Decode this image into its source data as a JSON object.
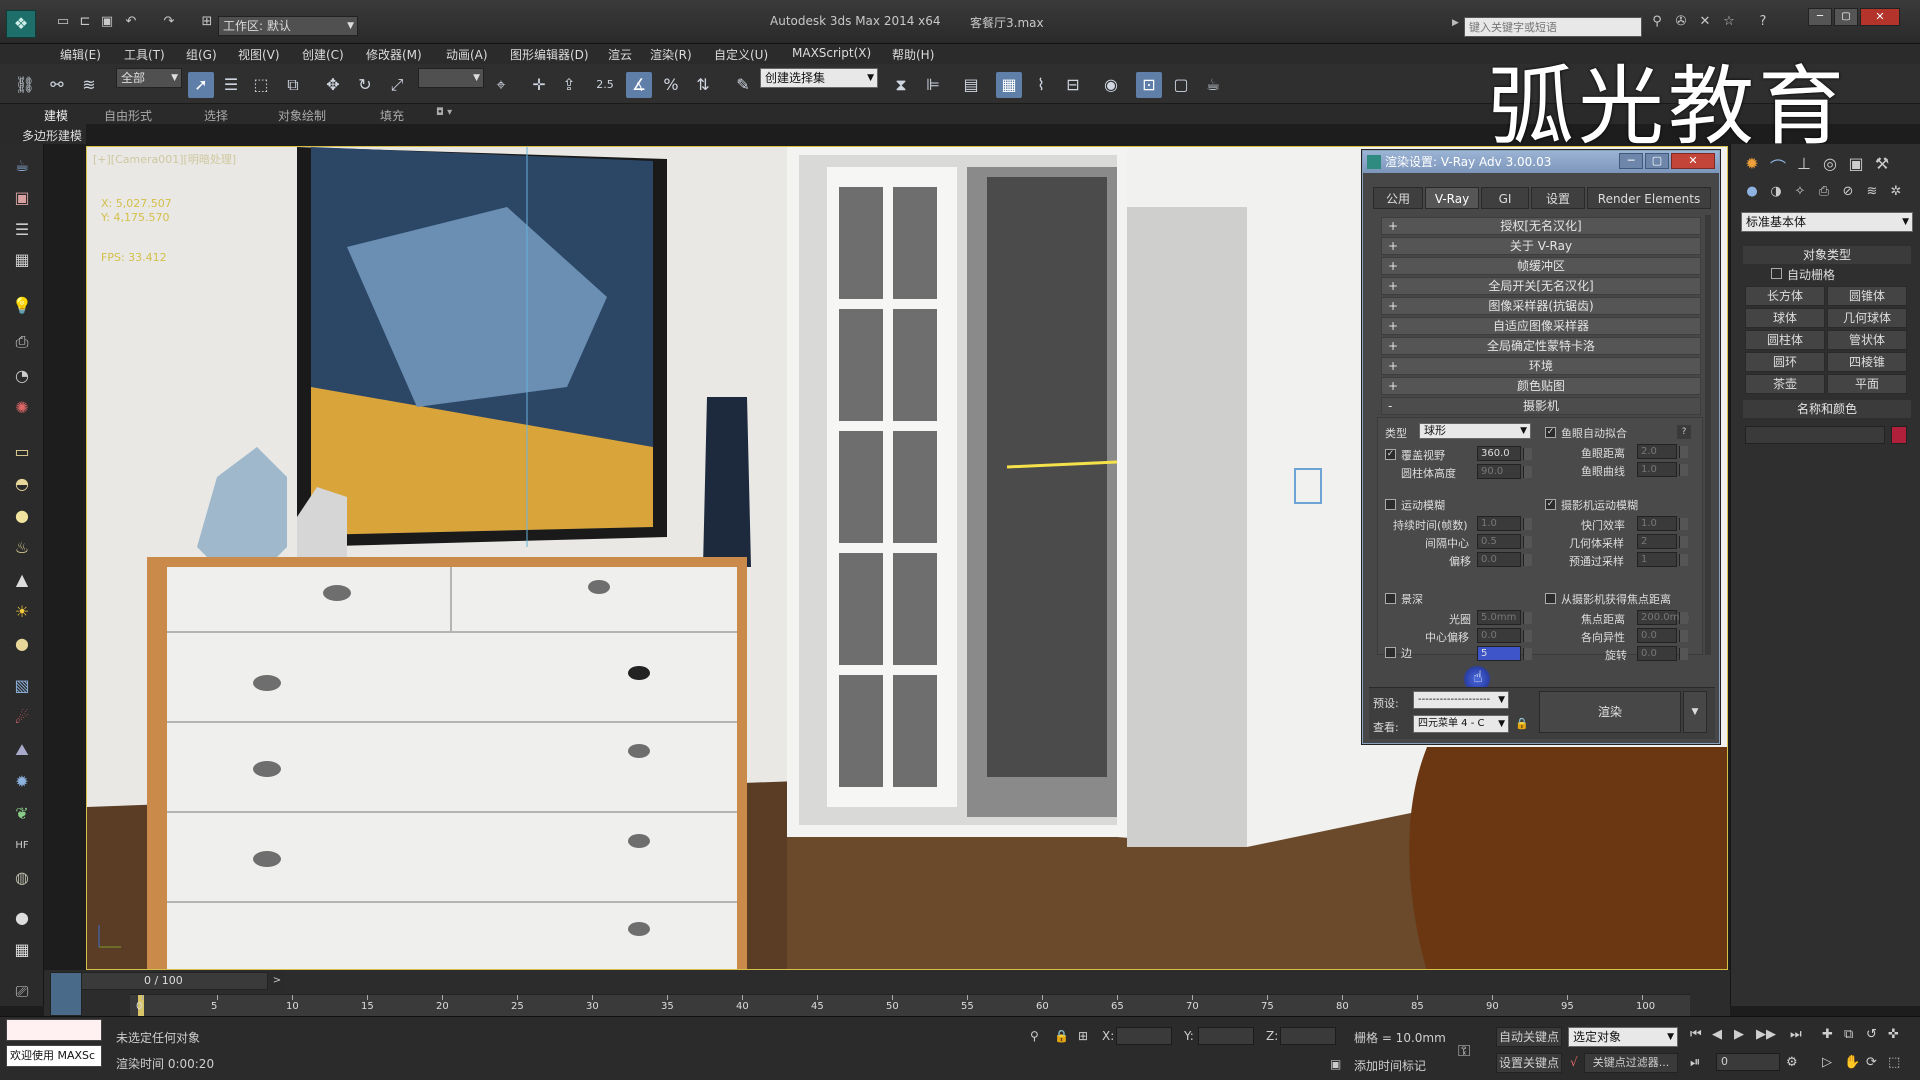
{
  "app": {
    "title": "Autodesk 3ds Max  2014 x64",
    "file": "客餐厅3.max",
    "workspace": "工作区: 默认",
    "search_placeholder": "键入关键字或短语"
  },
  "watermark": "弧光教育",
  "menus": [
    "编辑(E)",
    "工具(T)",
    "组(G)",
    "视图(V)",
    "创建(C)",
    "修改器(M)",
    "动画(A)",
    "图形编辑器(D)",
    "渲云",
    "渲染(R)",
    "自定义(U)",
    "MAXScript(X)",
    "帮助(H)"
  ],
  "toolbar": {
    "filter": "全部",
    "selection_set": "创建选择集",
    "snap_value": "2.5"
  },
  "ribbon": {
    "tabs": [
      "建模",
      "自由形式",
      "选择",
      "对象绘制",
      "填充"
    ],
    "subtitle": "多边形建模"
  },
  "viewport": {
    "label": "[+][Camera001][明暗处理]",
    "stat_x": "X: 5,027.507",
    "stat_y": "Y: 4,175.570",
    "fps": "FPS: 33.412"
  },
  "dialog": {
    "title": "渲染设置: V-Ray Adv 3.00.03",
    "tabs": [
      "公用",
      "V-Ray",
      "GI",
      "设置",
      "Render Elements"
    ],
    "rollouts": [
      "授权[无名汉化]",
      "关于 V-Ray",
      "帧缓冲区",
      "全局开关[无名汉化]",
      "图像采样器(抗锯齿)",
      "自适应图像采样器",
      "全局确定性蒙特卡洛",
      "环境",
      "颜色贴图",
      "摄影机"
    ],
    "camera": {
      "type_label": "类型",
      "type_value": "球形",
      "override_fov": "覆盖视野",
      "fov_value": "360.0",
      "cylinder_height": "圆柱体高度",
      "cylinder_value": "90.0",
      "fisheye_auto": "鱼眼自动拟合",
      "fisheye_dist": "鱼眼距离",
      "fisheye_dist_value": "2.0",
      "fisheye_curve": "鱼眼曲线",
      "fisheye_curve_value": "1.0",
      "motion_blur": "运动模糊",
      "duration": "持续时间(帧数)",
      "duration_value": "1.0",
      "interval_center": "间隔中心",
      "interval_value": "0.5",
      "bias": "偏移",
      "bias_value": "0.0",
      "camera_motion_blur": "摄影机运动模糊",
      "shutter": "快门效率",
      "shutter_value": "1.0",
      "geo_samples": "几何体采样",
      "geo_samples_value": "2",
      "prepass": "预通过采样",
      "prepass_value": "1",
      "dof": "景深",
      "aperture": "光圈",
      "aperture_value": "5.0mm",
      "center_bias": "中心偏移",
      "center_bias_value": "0.0",
      "sides": "边",
      "sides_value": "5",
      "from_camera": "从摄影机获得焦点距离",
      "focus_dist": "焦点距离",
      "focus_dist_value": "200.0mm",
      "anisotropy": "各向异性",
      "anisotropy_value": "0.0",
      "rotation": "旋转",
      "rotation_value": "0.0"
    },
    "preset_label": "预设:",
    "preset_value": "--------------------",
    "view_label": "查看:",
    "view_value": "四元菜单 4 - C",
    "render_button": "渲染"
  },
  "rightpanel": {
    "category": "标准基本体",
    "object_type": "对象类型",
    "auto_grid": "自动栅格",
    "buttons": [
      "长方体",
      "圆锥体",
      "球体",
      "几何球体",
      "圆柱体",
      "管状体",
      "圆环",
      "四棱锥",
      "茶壶",
      "平面"
    ],
    "name_color": "名称和颜色",
    "swatch": "#b0203a"
  },
  "timeline": {
    "frame": "0 / 100",
    "ticks": [
      "0",
      "5",
      "10",
      "15",
      "20",
      "25",
      "30",
      "35",
      "40",
      "45",
      "50",
      "55",
      "60",
      "65",
      "70",
      "75",
      "80",
      "85",
      "90",
      "95",
      "100"
    ]
  },
  "status": {
    "welcome": "欢迎使用 MAXSc",
    "no_selection": "未选定任何对象",
    "render_time": "渲染时间 0:00:20",
    "x_label": "X:",
    "y_label": "Y:",
    "z_label": "Z:",
    "grid": "栅格 = 10.0mm",
    "auto_key": "自动关键点",
    "selected": "选定对象",
    "set_key": "设置关键点",
    "key_filter": "关键点过滤器...",
    "add_tag": "添加时间标记",
    "frame_field": "0"
  }
}
